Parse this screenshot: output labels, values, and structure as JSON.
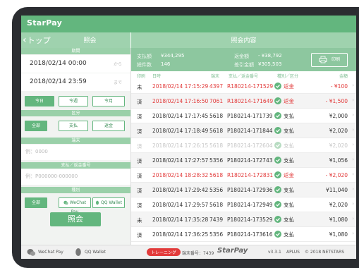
{
  "app": {
    "title": "StarPay"
  },
  "header": {
    "back_label": "トップ",
    "left_title": "照会",
    "right_title": "照会内容"
  },
  "left": {
    "period": {
      "section": "期間",
      "from": {
        "value": "2018/02/14 00:00",
        "suffix": "から"
      },
      "to": {
        "value": "2018/02/14 23:59",
        "suffix": "まで"
      },
      "buttons": [
        "今日",
        "今週",
        "今月"
      ]
    },
    "category": {
      "section": "区分",
      "buttons": [
        "全部",
        "支払",
        "返金"
      ]
    },
    "terminal": {
      "section": "端末",
      "placeholder": "例：0000"
    },
    "payment_no": {
      "section": "支払／返金番号",
      "placeholder": "例：P000000-000000"
    },
    "kind": {
      "section": "種別",
      "buttons": [
        "全部",
        "WeChat Pay",
        "QQ Wallet"
      ]
    },
    "query_label": "照会"
  },
  "summary": {
    "pay_amount_label": "支払額",
    "pay_amount": "¥344,295",
    "refund_amount_label": "返金額",
    "refund_amount": "- ¥38,792",
    "count_label": "総件数",
    "count": "146",
    "net_label": "差引金額",
    "net": "¥305,503",
    "print_label": "印刷"
  },
  "columns": [
    "印刷",
    "日時",
    "端末",
    "支払／返金番号",
    "種別／区分",
    "金額"
  ],
  "transactions": [
    {
      "printed": "未",
      "date": "2018/02/14 17:15:29",
      "terminal": "4397",
      "txn": "R180214-171529",
      "kind": "返金",
      "amount": "- ¥100",
      "refund": true,
      "faded": false
    },
    {
      "printed": "済",
      "date": "2018/02/14 17:16:50",
      "terminal": "7061",
      "txn": "R180214-171649",
      "kind": "返金",
      "amount": "- ¥1,500",
      "refund": true,
      "faded": false
    },
    {
      "printed": "済",
      "date": "2018/02/14 17:17:45",
      "terminal": "5618",
      "txn": "P180214-171739",
      "kind": "支払",
      "amount": "¥2,000",
      "refund": false,
      "faded": false
    },
    {
      "printed": "済",
      "date": "2018/02/14 17:18:49",
      "terminal": "5618",
      "txn": "P180214-171844",
      "kind": "支払",
      "amount": "¥2,020",
      "refund": false,
      "faded": false
    },
    {
      "printed": "済",
      "date": "2018/02/14 17:26:15",
      "terminal": "5618",
      "txn": "P180214-172604",
      "kind": "支払",
      "amount": "¥2,020",
      "refund": false,
      "faded": true
    },
    {
      "printed": "済",
      "date": "2018/02/14 17:27:57",
      "terminal": "5356",
      "txn": "P180214-172743",
      "kind": "支払",
      "amount": "¥1,056",
      "refund": false,
      "faded": false
    },
    {
      "printed": "済",
      "date": "2018/02/14 18:28:32",
      "terminal": "5618",
      "txn": "R180214-172831",
      "kind": "返金",
      "amount": "- ¥2,020",
      "refund": true,
      "faded": false
    },
    {
      "printed": "済",
      "date": "2018/02/14 17:29:42",
      "terminal": "5356",
      "txn": "P180214-172936",
      "kind": "支払",
      "amount": "¥11,040",
      "refund": false,
      "faded": false
    },
    {
      "printed": "済",
      "date": "2018/02/14 17:29:57",
      "terminal": "5618",
      "txn": "P180214-172949",
      "kind": "支払",
      "amount": "¥2,020",
      "refund": false,
      "faded": false
    },
    {
      "printed": "未",
      "date": "2018/02/14 17:35:28",
      "terminal": "7439",
      "txn": "P180214-173529",
      "kind": "支払",
      "amount": "¥1,080",
      "refund": false,
      "faded": false
    },
    {
      "printed": "済",
      "date": "2018/02/14 17:36:25",
      "terminal": "5356",
      "txn": "P180214-173616",
      "kind": "支払",
      "amount": "¥1,080",
      "refund": false,
      "faded": false
    }
  ],
  "footer": {
    "wechat": "WeChat Pay",
    "qq": "QQ Wallet",
    "training": "トレーニング",
    "terminal_no": "端末番号：7439",
    "logo": "StarPay",
    "version": "v3.3.1",
    "vendor": "APLUS",
    "copyright": "© 2018 NETSTARS"
  },
  "colors": {
    "accent": "#63b67e",
    "header": "#9fd2ae",
    "summary": "#8dc79f",
    "refund": "#e23b3b"
  }
}
